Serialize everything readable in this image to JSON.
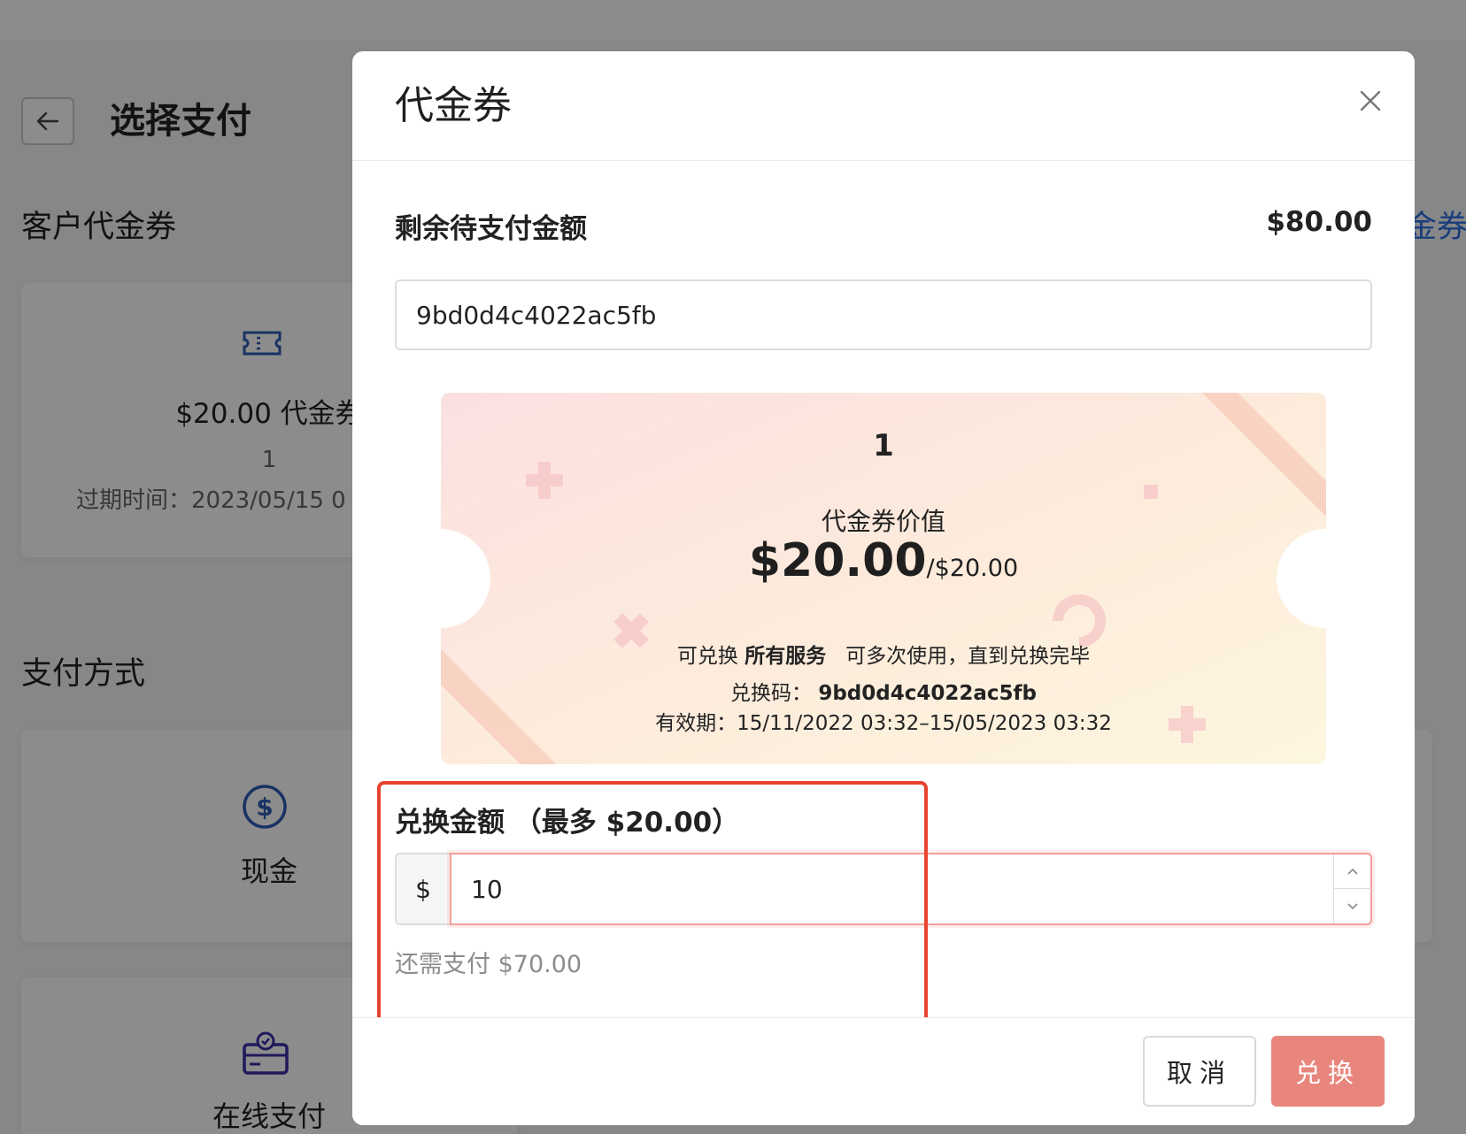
{
  "background": {
    "page_title": "选择支付",
    "section_vouchers": "客户代金券",
    "voucher_card": {
      "amount": "$20.00 代金券",
      "count": "1",
      "expiry": "过期时间：2023/05/15 0"
    },
    "section_payment": "支付方式",
    "payment_methods": [
      {
        "label": "现金",
        "icon": "dollar-circle-icon"
      },
      {
        "label": "在线支付",
        "icon": "online-payment-icon"
      }
    ],
    "right_link_partial": "金券"
  },
  "modal": {
    "title": "代金券",
    "close_icon": "close-icon",
    "remaining_label": "剩余待支付金额",
    "remaining_value": "$80.00",
    "code_input_value": "9bd0d4c4022ac5fb",
    "ticket": {
      "count": "1",
      "value_label": "代金券价值",
      "value_main": "$20.00",
      "value_sub": "/$20.00",
      "usage_prefix": "可兑换",
      "usage_scope": "所有服务",
      "usage_rule": "可多次使用，直到兑换完毕",
      "code_label": "兑换码：",
      "code_value": "9bd0d4c4022ac5fb",
      "validity": "有效期：15/11/2022 03:32–15/05/2023 03:32"
    },
    "redeem_label": "兑换金额 （最多 $20.00）",
    "currency_prefix": "$",
    "redeem_amount_value": "10",
    "still_to_pay": "还需支付 $70.00",
    "cancel_label": "取消",
    "redeem_button_label": "兑换"
  },
  "colors": {
    "accent_red": "#e8432e",
    "redeem_button": "#e8867d",
    "link_blue": "#2f6fe0",
    "icon_blue": "#2f5bb7"
  }
}
